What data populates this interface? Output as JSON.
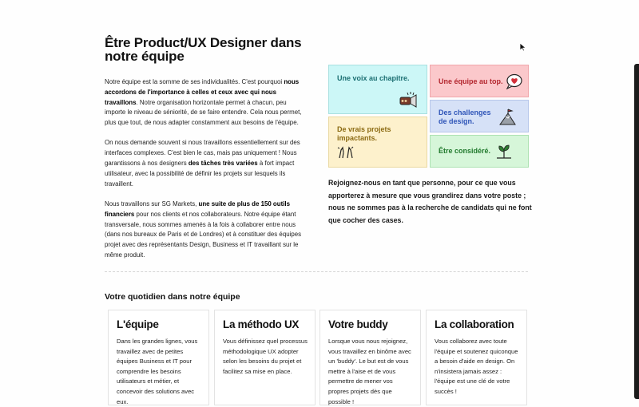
{
  "header": {
    "title": "Être Product/UX Designer dans notre équipe"
  },
  "intro": {
    "p1_a": "Notre équipe est la somme de ses individualités. C'est pourquoi ",
    "p1_b": "nous accordons de l'importance à celles et ceux avec qui nous travaillons",
    "p1_c": ". Notre organisation horizontale permet à chacun, peu importe le niveau de séniorité, de se faire entendre. Cela nous permet, plus que tout, de nous adapter constamment aux besoins de l'équipe.",
    "p2_a": "On nous demande souvent si nous travaillons essentiellement sur des interfaces complexes. C'est bien le cas, mais pas uniquement ! Nous garantissons à nos designers ",
    "p2_b": "des tâches très variées",
    "p2_c": " à fort impact utilisateur, avec la possibilité de définir les projets sur lesquels ils travaillent.",
    "p3_a": "Nous travaillons sur SG Markets, ",
    "p3_b": "une suite de plus de 150 outils financiers",
    "p3_c": " pour nos clients et nos collaborateurs. Notre équipe étant transversale, nous sommes amenés à la fois à collaborer entre nous (dans nos bureaux de Paris et de Londres) et à constituer des équipes projet avec des représentants Design, Business et IT travaillant sur le même produit."
  },
  "values": [
    {
      "label": "Une voix au chapitre.",
      "icon": "megaphone-icon",
      "color": "#ccf7f7"
    },
    {
      "label": "Une équipe au top.",
      "icon": "heart-bubble-icon",
      "color": "#fbc8cb"
    },
    {
      "label": "Des challenges de design.",
      "icon": "mountain-flag-icon",
      "color": "#d6e1f7"
    },
    {
      "label": "De vrais projets impactants.",
      "icon": "hands-up-icon",
      "color": "#fdf1cc"
    },
    {
      "label": "Être considéré.",
      "icon": "sprout-icon",
      "color": "#d6f6d9"
    }
  ],
  "join_text": "Rejoignez-nous en tant que personne, pour ce que vous apporterez à mesure que vous grandirez dans votre poste ; nous ne sommes pas à la recherche de candidats qui ne font que cocher des cases.",
  "daily": {
    "title": "Votre quotidien dans notre équipe",
    "cards": [
      {
        "title": "L'équipe",
        "text": "Dans les grandes lignes, vous travaillez avec de petites équipes Business et IT pour comprendre les besoins utilisateurs et métier, et concevoir des solutions avec eux."
      },
      {
        "title": "La méthodo UX",
        "text": "Vous définissez quel processus méthodologique UX adopter selon les besoins du projet et facilitez sa mise en place."
      },
      {
        "title": "Votre buddy",
        "text": "Lorsque vous nous rejoignez, vous travaillez en binôme avec un 'buddy'. Le but est de vous mettre à l'aise et de vous permettre de mener vos propres projets dès que possible !"
      },
      {
        "title": "La collaboration",
        "text": "Vous collaborez avec toute l'équipe et soutenez quiconque a besoin d'aide en design. On n'insistera jamais assez : l'équipe est une clé de votre succès !"
      }
    ]
  }
}
